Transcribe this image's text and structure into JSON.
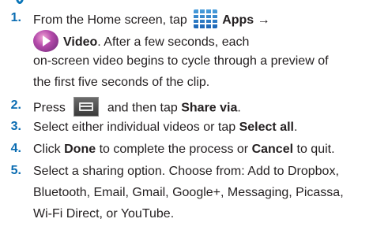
{
  "steps": [
    {
      "number": "1.",
      "pre": "From the Home screen, tap",
      "apps_label": "Apps →",
      "video_label": "Video",
      "after_video": ". After a few seconds, each",
      "line2": "on-screen video begins to cycle through a preview of",
      "line3": "the first five seconds of the clip."
    },
    {
      "number": "2.",
      "pre": "Press",
      "post": "and then tap",
      "bold": "Share via",
      "end": "."
    },
    {
      "number": "3.",
      "pre": "Select either individual videos or tap",
      "bold": "Select all",
      "end": "."
    },
    {
      "number": "4.",
      "pre": "Click",
      "bold1": "Done",
      "mid": "to complete the process or",
      "bold2": "Cancel",
      "end": "to quit."
    },
    {
      "number": "5.",
      "line1": "Select a sharing option. Choose from: Add to Dropbox,",
      "line2": "Bluetooth, Email, Gmail, Google+, Messaging, Picassa,",
      "line3": "Wi-Fi Direct, or YouTube."
    }
  ],
  "icons": [
    "apps-icon",
    "video-icon",
    "menu-icon"
  ],
  "colors": {
    "step_number": "#0a6cb2",
    "text": "#231f20",
    "apps_icon": "#2f86cf",
    "video_icon": "#b54bab"
  }
}
